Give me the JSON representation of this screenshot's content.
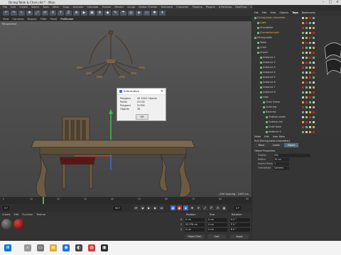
{
  "window": {
    "title": "Dining-Table & Chair.c4d * - Main"
  },
  "menu": [
    "File",
    "Edit",
    "Create",
    "Select",
    "Tools",
    "Mesh",
    "Snap",
    "Animate",
    "Simulate",
    "Tracker",
    "Render",
    "Sculpt",
    "Motion Tracker",
    "MoGraph",
    "Character",
    "Pipeline",
    "Plugins",
    "X-Particles",
    "RealFlow",
    "Octane",
    "Script",
    "Window",
    "Help"
  ],
  "toolbar": {
    "buttons": [
      {
        "label": "↶",
        "icon": "undo-icon"
      },
      {
        "label": "↷",
        "icon": "redo-icon"
      },
      {
        "label": "↖",
        "icon": "select-icon"
      },
      {
        "label": "✥",
        "icon": "move-icon"
      },
      {
        "label": "⤢",
        "icon": "scale-icon"
      },
      {
        "label": "⟳",
        "icon": "rotate-icon"
      },
      {
        "label": "X",
        "icon": "x-axis-icon"
      },
      {
        "label": "Y",
        "icon": "y-axis-icon"
      },
      {
        "label": "Z",
        "icon": "z-axis-icon"
      },
      {
        "label": "⊕",
        "icon": "coord-icon"
      },
      {
        "label": "▶",
        "icon": "render-view-icon"
      },
      {
        "label": "▣",
        "icon": "render-picture-icon"
      },
      {
        "label": "⚙",
        "icon": "render-settings-icon"
      },
      {
        "label": "◆",
        "icon": "cube-icon"
      },
      {
        "label": "✎",
        "icon": "pen-icon"
      },
      {
        "label": "☂",
        "icon": "subdivision-icon"
      },
      {
        "label": "◎",
        "icon": "array-icon"
      },
      {
        "label": "◈",
        "icon": "deformer-icon"
      },
      {
        "label": "▭",
        "icon": "floor-icon"
      },
      {
        "label": "✱",
        "icon": "camera-icon"
      },
      {
        "label": "☀",
        "icon": "light-icon"
      }
    ]
  },
  "viewport_tabs": [
    "View",
    "Cameras",
    "Display",
    "Filter",
    "Panel",
    "ProRender"
  ],
  "viewport": {
    "label": "Perspective",
    "grid_spacing": "Grid Spacing : 1000 cm"
  },
  "dialog": {
    "title": "Information",
    "rows": [
      {
        "label": "Polygons",
        "value": "45 3322 Objects"
      },
      {
        "label": "Points",
        "value": "47132"
      },
      {
        "label": "Polygons",
        "value": "51392"
      },
      {
        "label": "Objects",
        "value": "36"
      }
    ],
    "ok": "OK"
  },
  "timeline": {
    "ticks": [
      "0",
      "10",
      "20",
      "30",
      "40",
      "50",
      "60",
      "70",
      "80",
      "90"
    ],
    "frame_start": "0 F",
    "frame_end": "90 F",
    "current": "0 F"
  },
  "material_panel": {
    "menu": [
      "Create",
      "Edit",
      "Function",
      "Texture"
    ]
  },
  "coordinates": {
    "headers": [
      "Position",
      "Size",
      "Rotation"
    ],
    "rows": [
      {
        "axis": "X",
        "pos": "0 cm",
        "size": "0 cm",
        "rot": "H 0 °"
      },
      {
        "axis": "Y",
        "pos": "92.376 cm",
        "size": "0 cm",
        "rot": "P 0 °"
      },
      {
        "axis": "Z",
        "pos": "0 cm",
        "size": "0 cm",
        "rot": "B 0 °"
      }
    ],
    "mode": "Object (Rel)",
    "size_mode": "Size",
    "apply": "Apply"
  },
  "object_manager": {
    "menu": [
      "File",
      "Edit",
      "View",
      "Objects",
      "Tags",
      "Bookmarks"
    ],
    "active_menu": "Tags",
    "items": [
      {
        "label": "Dining-table-chandelier",
        "depth": 0,
        "selected": true
      },
      {
        "label": "Light",
        "depth": 1,
        "selected": true
      },
      {
        "label": "Chandelier",
        "depth": 1,
        "selected": false
      },
      {
        "label": "Chandelier-light",
        "depth": 1,
        "selected": true
      },
      {
        "label": "Dining-table",
        "depth": 0,
        "selected": false
      },
      {
        "label": "Table",
        "depth": 1,
        "selected": false
      },
      {
        "label": "Chair",
        "depth": 1,
        "selected": false
      },
      {
        "label": "Chair2",
        "depth": 1,
        "selected": false
      },
      {
        "label": "Instance 1",
        "depth": 2,
        "selected": false
      },
      {
        "label": "Instance 2",
        "depth": 2,
        "selected": false
      },
      {
        "label": "Instance 3",
        "depth": 2,
        "selected": false
      },
      {
        "label": "Instance 4",
        "depth": 2,
        "selected": false
      },
      {
        "label": "Instance 5",
        "depth": 2,
        "selected": false
      },
      {
        "label": "Instance 6",
        "depth": 2,
        "selected": false
      },
      {
        "label": "Instance 7",
        "depth": 2,
        "selected": false
      },
      {
        "label": "Instance 8",
        "depth": 2,
        "selected": false
      },
      {
        "label": "Legs",
        "depth": 2,
        "selected": false
      },
      {
        "label": "Chair frame",
        "depth": 3,
        "selected": false
      },
      {
        "label": "Chair-leg",
        "depth": 3,
        "selected": false
      },
      {
        "label": "Backrest",
        "depth": 3,
        "selected": false
      },
      {
        "label": "Cushion-seats",
        "depth": 4,
        "selected": false
      },
      {
        "label": "Cushion-ins",
        "depth": 4,
        "selected": false
      },
      {
        "label": "Chair base",
        "depth": 4,
        "selected": false
      },
      {
        "label": "Instance 9",
        "depth": 4,
        "selected": false
      }
    ]
  },
  "attributes": {
    "tabs": [
      "Mode",
      "Edit",
      "User Data"
    ],
    "heading": "Null [Dining-table-chandelier]",
    "property_tabs": [
      "Basic",
      "Coord.",
      "Object"
    ],
    "active_property_tab": "Object",
    "section": "Object Properties",
    "props": [
      {
        "label": "Display",
        "value": "Dot"
      },
      {
        "label": "Radius",
        "value": "10 cm"
      },
      {
        "label": "Aspect Ratio",
        "value": "1"
      },
      {
        "label": "Orientation",
        "value": "Camera"
      }
    ]
  },
  "colors": {
    "accent": "#f0b64c",
    "x_axis": "#d23a3a",
    "y_axis": "#3fbf3f",
    "z_axis": "#3b6fd0"
  }
}
